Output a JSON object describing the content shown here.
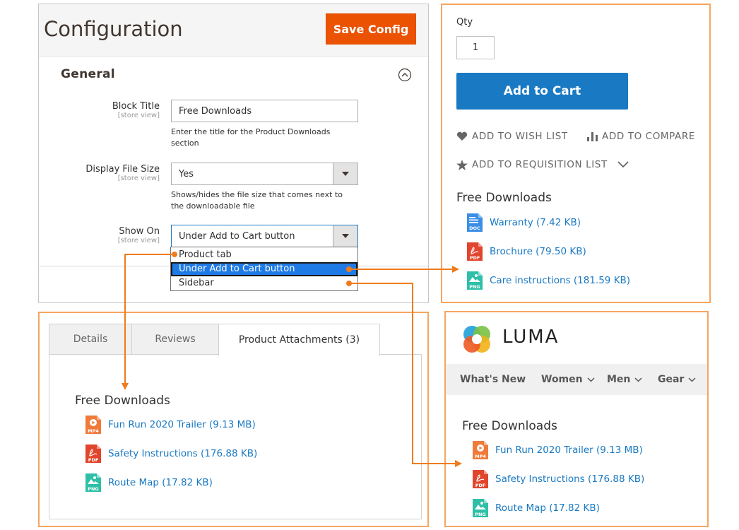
{
  "config": {
    "title": "Configuration",
    "save_label": "Save Config",
    "section_title": "General",
    "fields": {
      "block_title": {
        "label": "Block Title",
        "scope": "[store view]",
        "value": "Free Downloads",
        "note": "Enter the title for the Product Downloads section"
      },
      "display_file_size": {
        "label": "Display File Size",
        "scope": "[store view]",
        "value": "Yes",
        "note": "Shows/hides the file size that comes next to the downloadable file"
      },
      "show_on": {
        "label": "Show On",
        "scope": "[store view]",
        "value": "Under Add to Cart button"
      }
    },
    "dropdown_options": [
      "Product tab",
      "Under Add to Cart button",
      "Sidebar"
    ]
  },
  "product": {
    "qty_label": "Qty",
    "qty_value": "1",
    "add_to_cart": "Add to Cart",
    "wishlist": "ADD TO WISH LIST",
    "compare": "ADD TO COMPARE",
    "requisition": "ADD TO REQUISITION LIST",
    "downloads_title": "Free Downloads",
    "files": [
      {
        "label": "Warranty (7.42 KB)",
        "type": "DOC",
        "color": "#3a8ee6"
      },
      {
        "label": "Brochure (79.50 KB)",
        "type": "PDF",
        "color": "#e2452d"
      },
      {
        "label": "Care instructions (181.59 KB)",
        "type": "PNG",
        "color": "#2fbfa7"
      }
    ]
  },
  "tabs": {
    "items": [
      "Details",
      "Reviews",
      "Product Attachments (3)"
    ],
    "downloads_title": "Free Downloads",
    "files": [
      {
        "label": "Fun Run 2020 Trailer (9.13 MB)",
        "type": "MP4",
        "color": "#f07a3a"
      },
      {
        "label": "Safety Instructions (176.88 KB)",
        "type": "PDF",
        "color": "#e2452d"
      },
      {
        "label": "Route Map (17.82 KB)",
        "type": "PNG",
        "color": "#2fbfa7"
      }
    ]
  },
  "luma": {
    "brand": "LUMA",
    "nav": [
      "What's New",
      "Women",
      "Men",
      "Gear"
    ],
    "downloads_title": "Free Downloads",
    "files": [
      {
        "label": "Fun Run 2020 Trailer (9.13 MB)",
        "type": "MP4",
        "color": "#f07a3a"
      },
      {
        "label": "Safety Instructions (176.88 KB)",
        "type": "PDF",
        "color": "#e2452d"
      },
      {
        "label": "Route Map (17.82 KB)",
        "type": "PNG",
        "color": "#2fbfa7"
      }
    ]
  },
  "colors": {
    "accent_orange": "#eb5202",
    "arrow_orange": "#f07c1c",
    "link_blue": "#1979c3"
  }
}
